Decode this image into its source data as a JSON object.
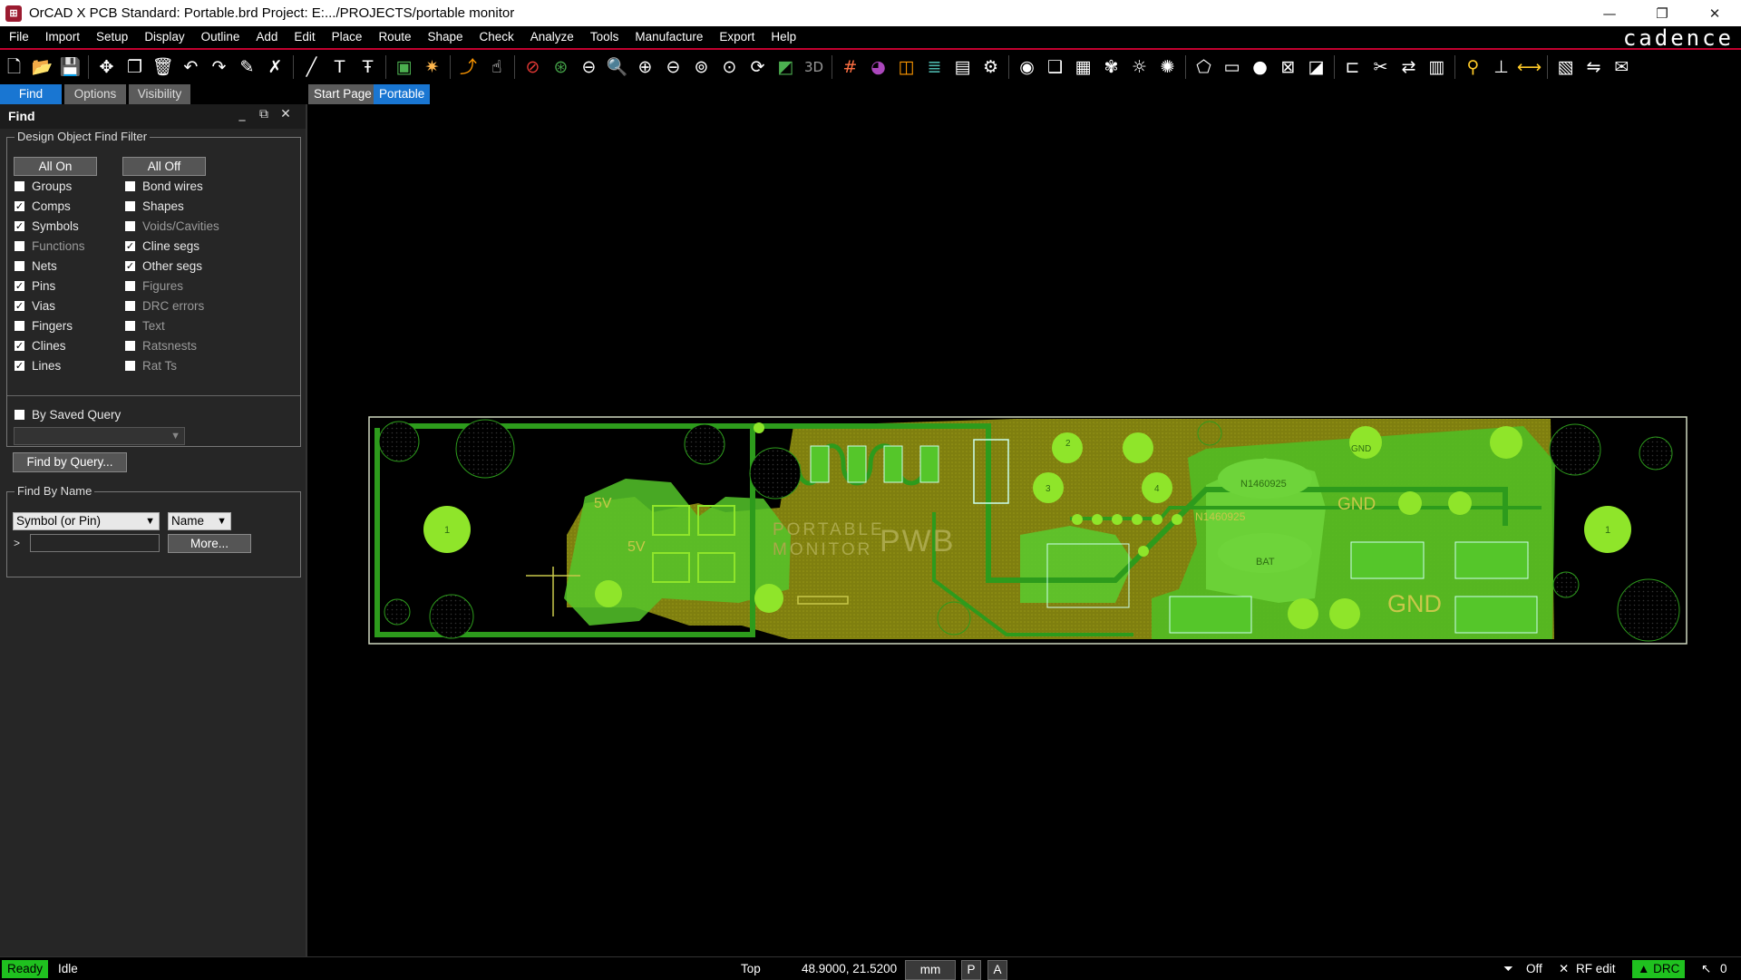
{
  "window": {
    "title": "OrCAD X PCB Standard: Portable.brd  Project: E:.../PROJECTS/portable monitor",
    "controls": [
      "—",
      "❐",
      "✕"
    ]
  },
  "menu": [
    "File",
    "Import",
    "Setup",
    "Display",
    "Outline",
    "Add",
    "Edit",
    "Place",
    "Route",
    "Shape",
    "Check",
    "Analyze",
    "Tools",
    "Manufacture",
    "Export",
    "Help"
  ],
  "brand": "cadence",
  "panel_tabs": [
    "Find",
    "Options",
    "Visibility"
  ],
  "doc_tabs": [
    "Start Page",
    "Portable"
  ],
  "find_panel": {
    "title": "Find",
    "filter_group": "Design Object Find Filter",
    "all_on": "All On",
    "all_off": "All Off",
    "left_items": [
      {
        "label": "Groups",
        "checked": false,
        "enabled": true
      },
      {
        "label": "Comps",
        "checked": true,
        "enabled": true
      },
      {
        "label": "Symbols",
        "checked": true,
        "enabled": true
      },
      {
        "label": "Functions",
        "checked": false,
        "enabled": false
      },
      {
        "label": "Nets",
        "checked": false,
        "enabled": true
      },
      {
        "label": "Pins",
        "checked": true,
        "enabled": true
      },
      {
        "label": "Vias",
        "checked": true,
        "enabled": true
      },
      {
        "label": "Fingers",
        "checked": false,
        "enabled": true
      },
      {
        "label": "Clines",
        "checked": true,
        "enabled": true
      },
      {
        "label": "Lines",
        "checked": true,
        "enabled": true
      }
    ],
    "right_items": [
      {
        "label": "Bond wires",
        "checked": false,
        "enabled": true
      },
      {
        "label": "Shapes",
        "checked": false,
        "enabled": true
      },
      {
        "label": "Voids/Cavities",
        "checked": false,
        "enabled": false
      },
      {
        "label": "Cline segs",
        "checked": true,
        "enabled": true
      },
      {
        "label": "Other segs",
        "checked": true,
        "enabled": true
      },
      {
        "label": "Figures",
        "checked": false,
        "enabled": false
      },
      {
        "label": "DRC errors",
        "checked": false,
        "enabled": false
      },
      {
        "label": "Text",
        "checked": false,
        "enabled": false
      },
      {
        "label": "Ratsnests",
        "checked": false,
        "enabled": false
      },
      {
        "label": "Rat Ts",
        "checked": false,
        "enabled": false
      }
    ],
    "by_saved_query": "By Saved Query",
    "find_by_query": "Find by Query...",
    "find_by_name_group": "Find By Name",
    "type_select": "Symbol (or Pin)",
    "name_select": "Name",
    "prompt": ">",
    "more": "More..."
  },
  "board": {
    "silk_title_1": "PORTABLE",
    "silk_title_2": "MONITOR",
    "silk_pwb": "PWB",
    "labels": [
      "5V",
      "5V",
      "GND",
      "GND",
      "GND",
      "BAT",
      "N1460925",
      "N1460925",
      "1",
      "2",
      "3",
      "4"
    ],
    "colors": {
      "board_edge": "#cfd8c0",
      "copper_green": "#55d12a",
      "pad": "#8fe52a",
      "shape_olive": "#8a8a0f",
      "trace": "#2d9b1c"
    }
  },
  "status": {
    "ready": "Ready",
    "state": "Idle",
    "layer": "Top",
    "coords": "48.9000, 21.5200",
    "units": "mm",
    "p": "P",
    "a": "A",
    "filter": "Off",
    "rf": "RF edit",
    "drc": "DRC",
    "count": "0"
  }
}
